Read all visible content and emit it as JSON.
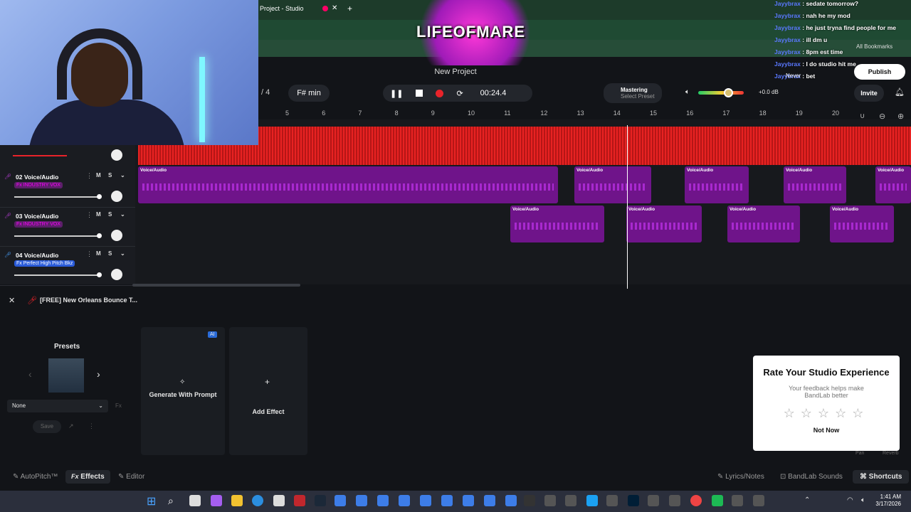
{
  "browser": {
    "tab_title": "Project - Studio",
    "bookmarks": "All Bookmarks"
  },
  "stream": {
    "logo_text": "LIFEOFMARE"
  },
  "project": {
    "name": "New Project"
  },
  "chat": [
    {
      "user": "Jayybrax",
      "msg": "sedate tomorrow?"
    },
    {
      "user": "Jayybrax",
      "msg": "nah he my mod"
    },
    {
      "user": "Jayybrax",
      "msg": "he just tryna find people for me"
    },
    {
      "user": "Jayybrax",
      "msg": "ill dm u"
    },
    {
      "user": "Jayybrax",
      "msg": "8pm est time"
    },
    {
      "user": "Jayybrax",
      "msg": "I do studio hit me"
    },
    {
      "user": "Jayybrax",
      "msg": "bet"
    }
  ],
  "transport": {
    "bars": "/ 4",
    "key": "F# min",
    "time": "00:24.4",
    "mastering_title": "Mastering",
    "mastering_sub": "Select Preset",
    "volume": "+0.0 dB",
    "invite": "Invite",
    "publish": "Publish",
    "never": "Never",
    "notif_count": "1"
  },
  "ruler": [
    "5",
    "6",
    "7",
    "8",
    "9",
    "10",
    "11",
    "12",
    "13",
    "14",
    "15",
    "16",
    "17",
    "18",
    "19",
    "20"
  ],
  "tracks": [
    {
      "num": "02",
      "name": "Voice/Audio",
      "fx": "Fx INDUSTRY VOX",
      "fx_style": "purple"
    },
    {
      "num": "03",
      "name": "Voice/Audio",
      "fx": "Fx INDUSTRY VOX",
      "fx_style": "purple"
    },
    {
      "num": "04",
      "name": "Voice/Audio",
      "fx": "Fx Perfect High Pitch Bkz",
      "fx_style": "blue"
    }
  ],
  "clip_label": "Voice/Audio",
  "fx_panel": {
    "track_title": "[FREE] New Orleans Bounce T...",
    "presets_label": "Presets",
    "preset_value": "None",
    "save": "Save",
    "generate": "Generate With Prompt",
    "ai_badge": "AI",
    "add_effect": "Add Effect",
    "pan": "Pan",
    "reverb": "Reverb"
  },
  "rating": {
    "title": "Rate Your Studio Experience",
    "subtitle": "Your feedback helps make BandLab better",
    "not_now": "Not Now",
    "stars": 5
  },
  "footer": {
    "autopitch": "AutoPitch™",
    "effects": "Effects",
    "editor": "Editor",
    "lyrics": "Lyrics/Notes",
    "sounds": "BandLab Sounds",
    "shortcuts": "Shortcuts"
  },
  "taskbar": {
    "time": "1:41 AM",
    "date": "3/17/2026"
  },
  "colors": {
    "master_track": "#d42020",
    "clip": "#6f148a",
    "accent": "#e8232a"
  }
}
